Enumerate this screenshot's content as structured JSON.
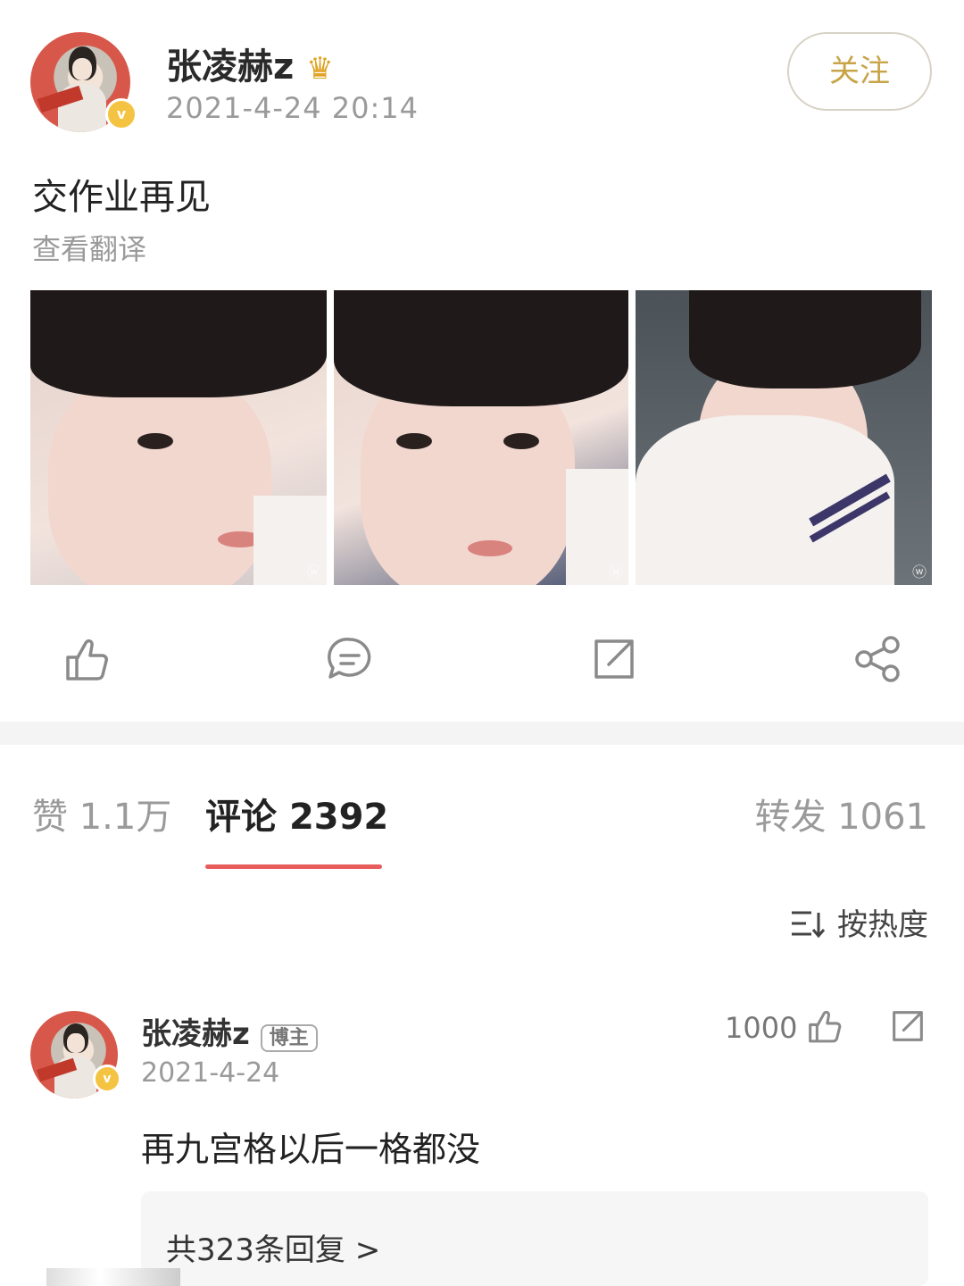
{
  "post": {
    "author": "张凌赫z",
    "crown_icon": "crown-icon",
    "verified_badge": "v",
    "timestamp": "2021-4-24 20:14",
    "follow_label": "关注",
    "text": "交作业再见",
    "translate_label": "查看翻译",
    "photo_count": 3
  },
  "actions": {
    "like_icon": "thumbs-up-icon",
    "comment_icon": "comment-icon",
    "repost_icon": "repost-icon",
    "share_icon": "share-icon"
  },
  "tabs": {
    "likes_label": "赞",
    "likes_count": "1.1万",
    "comments_label": "评论",
    "comments_count": "2392",
    "reposts_label": "转发",
    "reposts_count": "1061"
  },
  "sort": {
    "label": "按热度",
    "icon": "sort-icon"
  },
  "comment": {
    "author": "张凌赫z",
    "tag": "博主",
    "time": "2021-4-24",
    "likes": "1000",
    "text": "再九宫格以后一格都没",
    "replies": "共323条回复 >"
  },
  "colors": {
    "accent": "#e85c5c",
    "follow_text": "#c8a449",
    "muted": "#9a9a9a"
  }
}
